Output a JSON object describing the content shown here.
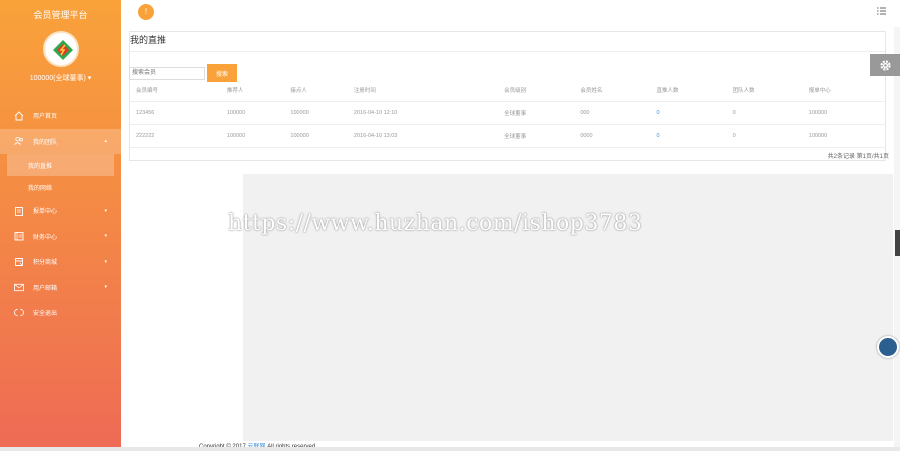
{
  "sidebar": {
    "brand": "会员管理平台",
    "user": "100000(全球董事) ▾",
    "menu": [
      {
        "label": "用户首页",
        "icon": "home-icon",
        "has_caret": false
      },
      {
        "label": "我的团队",
        "icon": "users-icon",
        "has_caret": true,
        "active": true
      },
      {
        "label": "报单中心",
        "icon": "clipboard-icon",
        "has_caret": true
      },
      {
        "label": "财务中心",
        "icon": "ledger-icon",
        "has_caret": true
      },
      {
        "label": "积分商城",
        "icon": "shop-icon",
        "has_caret": true
      },
      {
        "label": "用户邮箱",
        "icon": "mail-icon",
        "has_caret": true
      },
      {
        "label": "安全退出",
        "icon": "exit-icon",
        "has_caret": false
      }
    ],
    "submenu": [
      {
        "label": "我的直推",
        "active": true
      },
      {
        "label": "我的网络"
      }
    ]
  },
  "topbar": {
    "badge": "!"
  },
  "panel": {
    "title": "我的直推",
    "search_placeholder": "搜索会员",
    "search_button": "搜索",
    "columns": [
      "会员编号",
      "推荐人",
      "接点人",
      "注册时间",
      "会员级别",
      "会员姓名",
      "直推人数",
      "团队人数",
      "报单中心"
    ],
    "rows": [
      [
        "123456",
        "100000",
        "100000",
        "2016-04-10 12:10",
        "全球董事",
        "000",
        "0",
        "0",
        "100000"
      ],
      [
        "222222",
        "100000",
        "100000",
        "2016-04-10 13:03",
        "全球董事",
        "0000",
        "0",
        "0",
        "100000"
      ]
    ],
    "pager": "共2条记录 第1页/共1页"
  },
  "watermark": "https://www.huzhan.com/ishop3783",
  "footer": {
    "prefix": "Copyright © 2017 ",
    "link": "云联网",
    "suffix": " All rights reserved"
  },
  "colors": {
    "accent": "#f9a23a",
    "sidebar_bottom": "#ee6a55",
    "link": "#3b8fd6"
  }
}
